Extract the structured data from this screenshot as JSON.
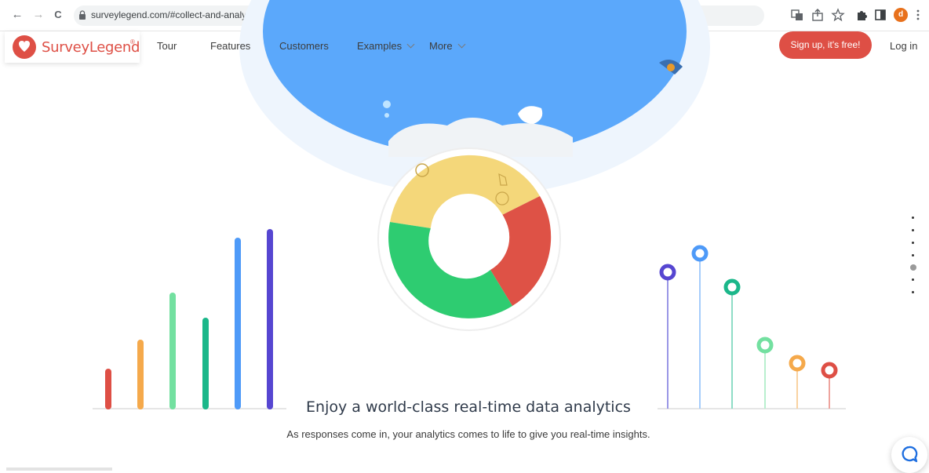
{
  "browser": {
    "url": "surveylegend.com/#collect-and-analyze-data",
    "back_icon": "←",
    "forward_icon": "→",
    "reload_icon": "C",
    "profile_initial": "d"
  },
  "header": {
    "brand": "SurveyLegend",
    "brand_mark": "®",
    "nav": [
      {
        "label": "Tour"
      },
      {
        "label": "Features"
      },
      {
        "label": "Customers"
      },
      {
        "label": "Examples"
      },
      {
        "label": "More"
      }
    ],
    "signup_label": "Sign up, it's free!",
    "login_label": "Log in"
  },
  "hero": {
    "title": "Enjoy a world-class real-time data analytics",
    "subtitle": "As responses come in, your analytics comes to life to give you real-time insights."
  },
  "colors": {
    "brand_red": "#de4f45",
    "globe_blue": "#5ba8fb",
    "donut_yellow": "#f4d77a",
    "donut_red": "#de5246",
    "donut_green": "#2ecc71"
  },
  "icons": {
    "lock": "lock-icon",
    "translate": "translate-icon",
    "share": "share-icon",
    "star": "star-icon",
    "extensions": "puzzle-icon",
    "sidebar": "sidebar-icon",
    "menu": "kebab-menu-icon",
    "chat": "chat-icon"
  }
}
